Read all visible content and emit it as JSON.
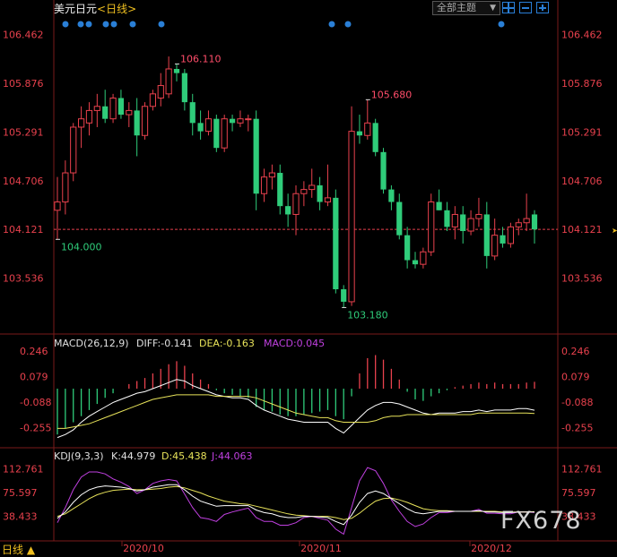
{
  "header": {
    "instrument": "美元日元",
    "period": "<日线>",
    "theme_button": "全部主题",
    "theme_arrow": "▼"
  },
  "price_axis_labels": [
    "106.462",
    "105.876",
    "105.291",
    "104.706",
    "104.121",
    "103.536"
  ],
  "macd_axis_labels": [
    "0.246",
    "0.079",
    "-0.088",
    "-0.255"
  ],
  "kdj_axis_labels": [
    "112.761",
    "75.597",
    "38.433"
  ],
  "date_labels": [
    "2020/10",
    "2020/11",
    "2020/12"
  ],
  "annotations": {
    "high1": "106.110",
    "high2": "105.680",
    "low1": "104.000",
    "low2": "103.180"
  },
  "macd_legend": {
    "name": "MACD(26,12,9)",
    "diff": "DIFF:-0.141",
    "dea": "DEA:-0.163",
    "macd": "MACD:0.045"
  },
  "kdj_legend": {
    "name": "KDJ(9,3,3)",
    "k": "K:44.979",
    "d": "D:45.438",
    "j": "J:44.063"
  },
  "footer": {
    "tab": "日线 ▲"
  },
  "watermark": "FX678",
  "colors": {
    "up": "#e8414d",
    "down": "#2fcc7a",
    "axis_text_price": "#e8414d",
    "diff": "#ffffff",
    "dea": "#e8e35a",
    "macd_bar_up": "#e8414d",
    "macd_bar_down": "#2fcc7a",
    "k": "#ffffff",
    "d": "#e8e35a",
    "j": "#c040e0",
    "dots": "#2a7fd6"
  },
  "chart_data": {
    "type": "candlestick",
    "price_range": [
      102.98,
      106.75
    ],
    "current_price": 104.121,
    "candles": [
      {
        "o": 104.35,
        "h": 104.75,
        "l": 104.0,
        "c": 104.45
      },
      {
        "o": 104.45,
        "h": 104.95,
        "l": 104.3,
        "c": 104.8
      },
      {
        "o": 104.8,
        "h": 105.4,
        "l": 104.7,
        "c": 105.35
      },
      {
        "o": 105.35,
        "h": 105.6,
        "l": 105.1,
        "c": 105.45
      },
      {
        "o": 105.4,
        "h": 105.65,
        "l": 105.25,
        "c": 105.55
      },
      {
        "o": 105.55,
        "h": 105.75,
        "l": 105.35,
        "c": 105.6
      },
      {
        "o": 105.6,
        "h": 105.8,
        "l": 105.4,
        "c": 105.45
      },
      {
        "o": 105.45,
        "h": 105.75,
        "l": 105.4,
        "c": 105.7
      },
      {
        "o": 105.7,
        "h": 105.8,
        "l": 105.45,
        "c": 105.5
      },
      {
        "o": 105.5,
        "h": 105.65,
        "l": 105.35,
        "c": 105.55
      },
      {
        "o": 105.55,
        "h": 105.7,
        "l": 105.0,
        "c": 105.25
      },
      {
        "o": 105.25,
        "h": 105.65,
        "l": 105.2,
        "c": 105.6
      },
      {
        "o": 105.6,
        "h": 105.8,
        "l": 105.55,
        "c": 105.75
      },
      {
        "o": 105.7,
        "h": 106.0,
        "l": 105.6,
        "c": 105.85
      },
      {
        "o": 105.75,
        "h": 106.2,
        "l": 105.7,
        "c": 106.05
      },
      {
        "o": 106.05,
        "h": 106.11,
        "l": 105.9,
        "c": 106.0
      },
      {
        "o": 106.0,
        "h": 106.05,
        "l": 105.55,
        "c": 105.65
      },
      {
        "o": 105.65,
        "h": 105.75,
        "l": 105.25,
        "c": 105.4
      },
      {
        "o": 105.4,
        "h": 105.55,
        "l": 105.2,
        "c": 105.3
      },
      {
        "o": 105.3,
        "h": 105.55,
        "l": 105.25,
        "c": 105.45
      },
      {
        "o": 105.45,
        "h": 105.5,
        "l": 105.05,
        "c": 105.1
      },
      {
        "o": 105.1,
        "h": 105.5,
        "l": 105.05,
        "c": 105.45
      },
      {
        "o": 105.45,
        "h": 105.5,
        "l": 105.3,
        "c": 105.4
      },
      {
        "o": 105.4,
        "h": 105.55,
        "l": 105.35,
        "c": 105.45
      },
      {
        "o": 105.45,
        "h": 105.5,
        "l": 105.3,
        "c": 105.45
      },
      {
        "o": 105.45,
        "h": 105.55,
        "l": 104.35,
        "c": 104.55
      },
      {
        "o": 104.55,
        "h": 104.85,
        "l": 104.45,
        "c": 104.75
      },
      {
        "o": 104.75,
        "h": 104.9,
        "l": 104.6,
        "c": 104.8
      },
      {
        "o": 104.8,
        "h": 104.9,
        "l": 104.3,
        "c": 104.4
      },
      {
        "o": 104.4,
        "h": 104.55,
        "l": 104.15,
        "c": 104.3
      },
      {
        "o": 104.3,
        "h": 104.65,
        "l": 104.05,
        "c": 104.55
      },
      {
        "o": 104.55,
        "h": 104.7,
        "l": 104.4,
        "c": 104.6
      },
      {
        "o": 104.6,
        "h": 104.85,
        "l": 104.5,
        "c": 104.65
      },
      {
        "o": 104.65,
        "h": 104.75,
        "l": 104.35,
        "c": 104.45
      },
      {
        "o": 104.45,
        "h": 104.9,
        "l": 104.4,
        "c": 104.5
      },
      {
        "o": 104.5,
        "h": 104.6,
        "l": 103.35,
        "c": 103.4
      },
      {
        "o": 103.4,
        "h": 103.45,
        "l": 103.18,
        "c": 103.25
      },
      {
        "o": 103.25,
        "h": 105.6,
        "l": 103.2,
        "c": 105.3
      },
      {
        "o": 105.3,
        "h": 105.5,
        "l": 105.15,
        "c": 105.25
      },
      {
        "o": 105.25,
        "h": 105.68,
        "l": 105.2,
        "c": 105.4
      },
      {
        "o": 105.4,
        "h": 105.45,
        "l": 105.0,
        "c": 105.05
      },
      {
        "o": 105.05,
        "h": 105.1,
        "l": 104.55,
        "c": 104.6
      },
      {
        "o": 104.6,
        "h": 104.65,
        "l": 104.35,
        "c": 104.45
      },
      {
        "o": 104.45,
        "h": 104.55,
        "l": 104.0,
        "c": 104.05
      },
      {
        "o": 104.05,
        "h": 104.15,
        "l": 103.65,
        "c": 103.75
      },
      {
        "o": 103.75,
        "h": 103.85,
        "l": 103.65,
        "c": 103.7
      },
      {
        "o": 103.7,
        "h": 103.9,
        "l": 103.65,
        "c": 103.85
      },
      {
        "o": 103.85,
        "h": 104.55,
        "l": 103.8,
        "c": 104.45
      },
      {
        "o": 104.45,
        "h": 104.6,
        "l": 104.35,
        "c": 104.35
      },
      {
        "o": 104.35,
        "h": 104.45,
        "l": 104.1,
        "c": 104.15
      },
      {
        "o": 104.15,
        "h": 104.4,
        "l": 104.0,
        "c": 104.3
      },
      {
        "o": 104.3,
        "h": 104.4,
        "l": 103.95,
        "c": 104.1
      },
      {
        "o": 104.1,
        "h": 104.35,
        "l": 104.05,
        "c": 104.25
      },
      {
        "o": 104.25,
        "h": 104.5,
        "l": 104.15,
        "c": 104.3
      },
      {
        "o": 104.3,
        "h": 104.45,
        "l": 103.65,
        "c": 103.8
      },
      {
        "o": 103.8,
        "h": 104.25,
        "l": 103.75,
        "c": 104.05
      },
      {
        "o": 104.05,
        "h": 104.15,
        "l": 103.9,
        "c": 103.95
      },
      {
        "o": 103.95,
        "h": 104.2,
        "l": 103.9,
        "c": 104.15
      },
      {
        "o": 104.15,
        "h": 104.25,
        "l": 104.05,
        "c": 104.2
      },
      {
        "o": 104.2,
        "h": 104.55,
        "l": 104.1,
        "c": 104.25
      },
      {
        "o": 104.3,
        "h": 104.35,
        "l": 103.95,
        "c": 104.12
      }
    ],
    "macd_hist": [
      -0.3,
      -0.26,
      -0.22,
      -0.18,
      -0.14,
      -0.1,
      -0.06,
      -0.03,
      0.0,
      0.03,
      0.05,
      0.07,
      0.1,
      0.13,
      0.16,
      0.18,
      0.15,
      0.1,
      0.06,
      0.03,
      -0.01,
      -0.03,
      -0.04,
      -0.05,
      -0.06,
      -0.12,
      -0.14,
      -0.15,
      -0.17,
      -0.18,
      -0.18,
      -0.17,
      -0.16,
      -0.15,
      -0.14,
      -0.18,
      -0.2,
      -0.05,
      0.1,
      0.2,
      0.22,
      0.19,
      0.13,
      0.06,
      -0.02,
      -0.07,
      -0.08,
      -0.05,
      -0.03,
      -0.01,
      0.01,
      0.02,
      0.03,
      0.04,
      0.03,
      0.04,
      0.03,
      0.03,
      0.03,
      0.04,
      0.045
    ],
    "macd_diff": [
      -0.32,
      -0.3,
      -0.27,
      -0.22,
      -0.18,
      -0.15,
      -0.12,
      -0.09,
      -0.07,
      -0.05,
      -0.03,
      -0.02,
      0.0,
      0.02,
      0.04,
      0.06,
      0.05,
      0.02,
      0.0,
      -0.02,
      -0.04,
      -0.05,
      -0.06,
      -0.06,
      -0.07,
      -0.11,
      -0.14,
      -0.16,
      -0.18,
      -0.2,
      -0.21,
      -0.22,
      -0.22,
      -0.22,
      -0.22,
      -0.26,
      -0.29,
      -0.24,
      -0.19,
      -0.14,
      -0.11,
      -0.09,
      -0.09,
      -0.1,
      -0.12,
      -0.14,
      -0.16,
      -0.17,
      -0.16,
      -0.16,
      -0.16,
      -0.15,
      -0.15,
      -0.14,
      -0.15,
      -0.14,
      -0.14,
      -0.14,
      -0.13,
      -0.13,
      -0.141
    ],
    "macd_dea": [
      -0.26,
      -0.26,
      -0.25,
      -0.24,
      -0.23,
      -0.21,
      -0.19,
      -0.17,
      -0.15,
      -0.13,
      -0.11,
      -0.09,
      -0.07,
      -0.06,
      -0.05,
      -0.04,
      -0.04,
      -0.04,
      -0.04,
      -0.04,
      -0.05,
      -0.05,
      -0.05,
      -0.05,
      -0.05,
      -0.06,
      -0.08,
      -0.1,
      -0.12,
      -0.14,
      -0.16,
      -0.17,
      -0.18,
      -0.19,
      -0.19,
      -0.21,
      -0.22,
      -0.22,
      -0.22,
      -0.22,
      -0.21,
      -0.19,
      -0.18,
      -0.18,
      -0.17,
      -0.17,
      -0.17,
      -0.17,
      -0.17,
      -0.17,
      -0.17,
      -0.17,
      -0.17,
      -0.16,
      -0.16,
      -0.16,
      -0.16,
      -0.16,
      -0.16,
      -0.16,
      -0.163
    ],
    "kdj_k": [
      35,
      45,
      60,
      72,
      80,
      84,
      86,
      85,
      84,
      82,
      78,
      80,
      84,
      86,
      88,
      88,
      80,
      70,
      62,
      58,
      54,
      55,
      55,
      55,
      55,
      48,
      44,
      42,
      38,
      36,
      36,
      38,
      38,
      37,
      36,
      30,
      25,
      40,
      60,
      74,
      78,
      74,
      66,
      58,
      50,
      44,
      42,
      44,
      46,
      46,
      46,
      46,
      46,
      47,
      45,
      45,
      44,
      44,
      45,
      45,
      44.979
    ],
    "kdj_d": [
      38,
      42,
      50,
      58,
      66,
      72,
      76,
      79,
      80,
      81,
      80,
      80,
      81,
      82,
      84,
      85,
      83,
      79,
      75,
      70,
      66,
      62,
      60,
      58,
      57,
      54,
      51,
      48,
      45,
      42,
      40,
      39,
      38,
      38,
      38,
      36,
      33,
      35,
      43,
      53,
      62,
      66,
      67,
      64,
      60,
      55,
      50,
      48,
      47,
      47,
      46,
      46,
      46,
      46,
      46,
      46,
      45,
      45,
      45,
      45,
      45.438
    ],
    "kdj_j": [
      28,
      52,
      80,
      100,
      108,
      108,
      105,
      97,
      92,
      85,
      74,
      80,
      90,
      94,
      96,
      94,
      73,
      52,
      36,
      34,
      30,
      41,
      45,
      48,
      51,
      36,
      30,
      30,
      24,
      24,
      28,
      36,
      38,
      35,
      32,
      18,
      10,
      52,
      94,
      115,
      110,
      90,
      64,
      46,
      30,
      22,
      26,
      36,
      44,
      44,
      46,
      46,
      46,
      49,
      43,
      43,
      42,
      42,
      45,
      45,
      44.063
    ]
  }
}
